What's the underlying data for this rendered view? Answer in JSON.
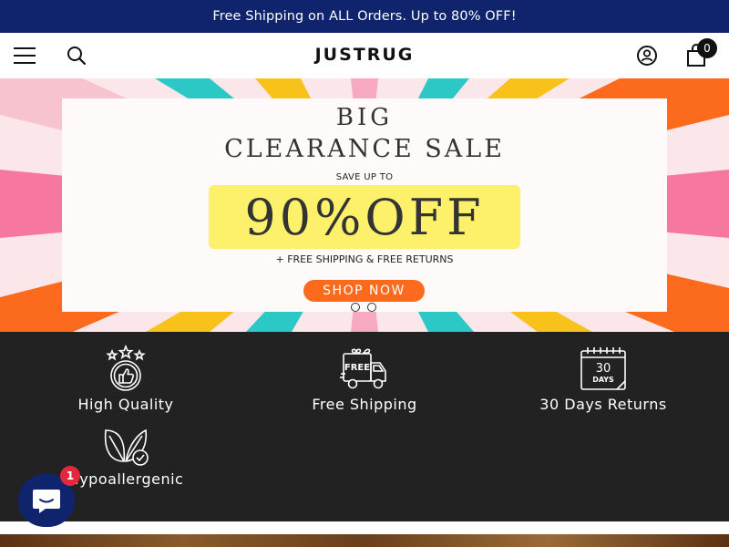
{
  "announcement": {
    "text": "Free Shipping on ALL Orders. Up to 80% OFF!"
  },
  "header": {
    "logo": "JUSTRUG",
    "icons": [
      "menu-icon",
      "search-icon",
      "account-icon",
      "cart-icon"
    ],
    "cart_count": "0"
  },
  "hero": {
    "line1": "BIG",
    "line2": "CLEARANCE SALE",
    "save_label": "SAVE UP TO",
    "discount": "90%OFF",
    "extras": "+ FREE SHIPPING & FREE RETURNS",
    "cta": "SHOP NOW",
    "slides": 2,
    "active_slide": 2,
    "colors": {
      "cta": "#fb6a1d",
      "highlight": "#fdf06a"
    }
  },
  "features": [
    {
      "icon": "stars-thumbs-up-icon",
      "label": "High Quality"
    },
    {
      "icon": "free-delivery-truck-icon",
      "label": "Free Shipping"
    },
    {
      "icon": "calendar-30-days-icon",
      "label": "30 Days Returns",
      "calendar_number": "30",
      "calendar_unit": "DAYS"
    },
    {
      "icon": "leaves-check-icon",
      "label": "Hypoallergenic"
    }
  ],
  "chat": {
    "icon": "chat-bubble-icon",
    "badge": "1"
  },
  "colors": {
    "brand": "#10246e",
    "feature_bg": "#222222",
    "badge": "#e3283e"
  }
}
